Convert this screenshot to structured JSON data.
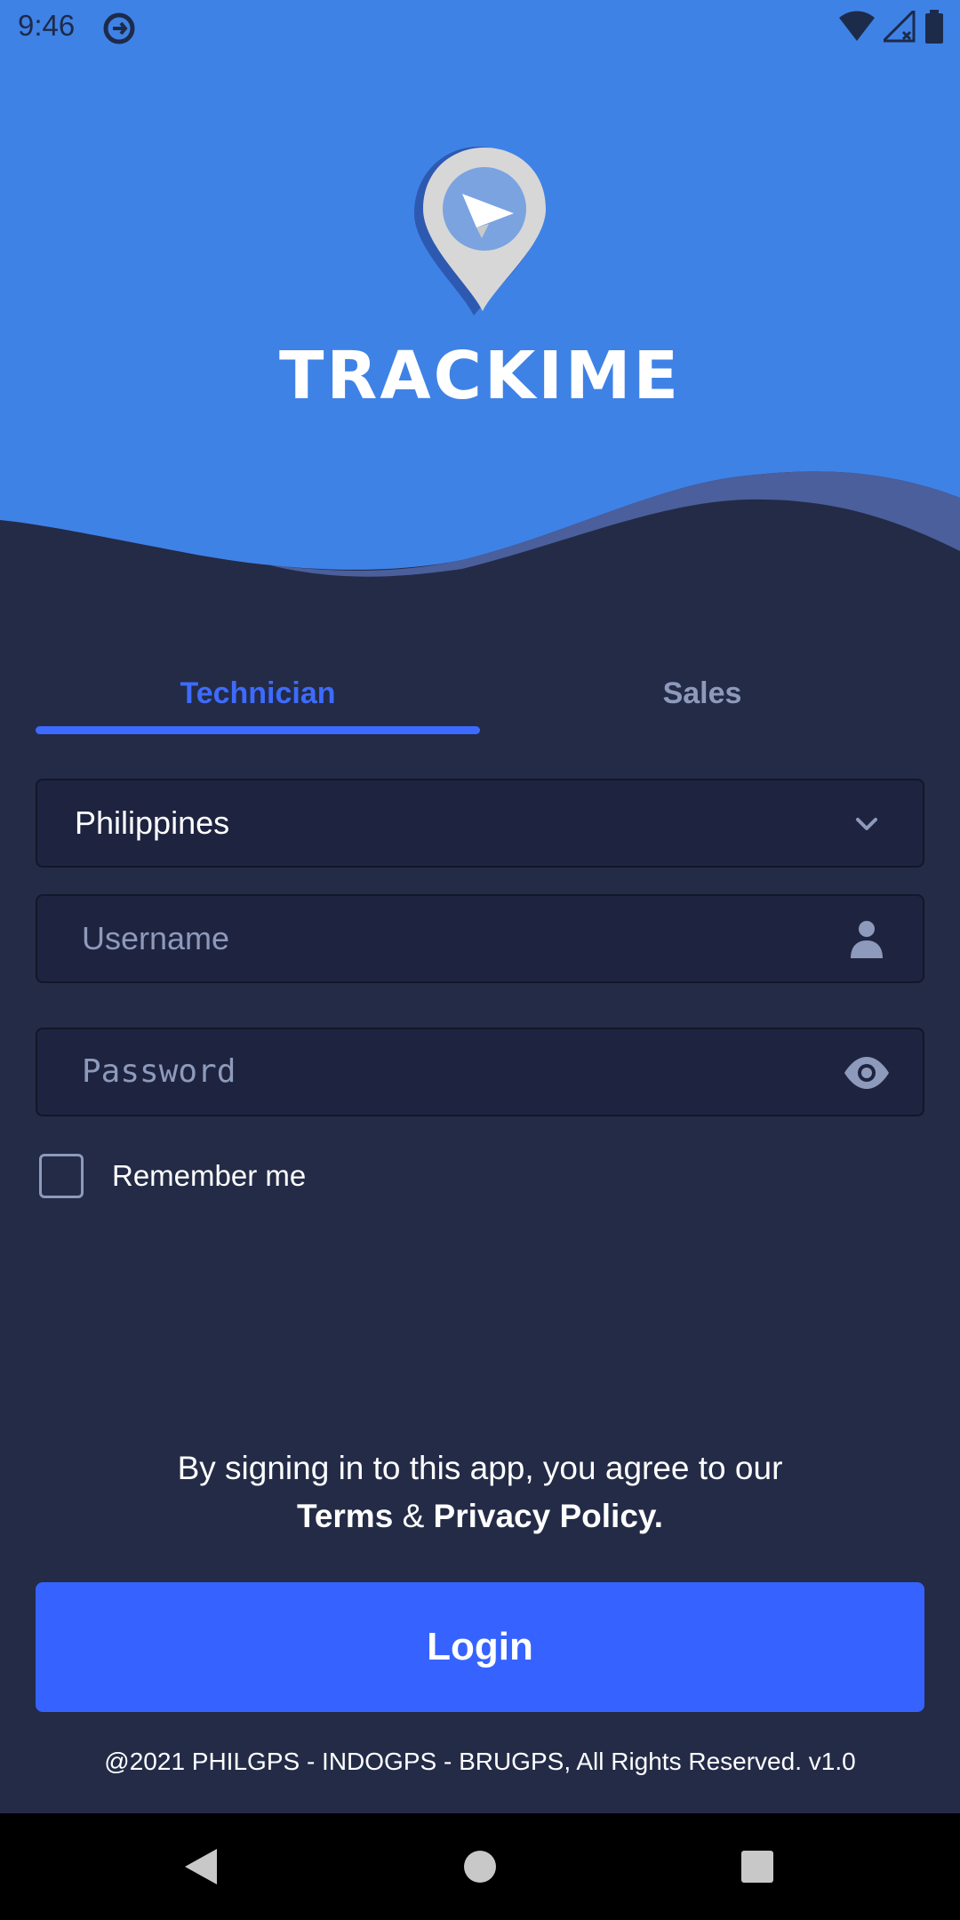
{
  "status_bar": {
    "time": "9:46",
    "icons": [
      "sync-icon",
      "wifi-icon",
      "signal-icon",
      "battery-icon"
    ]
  },
  "brand": {
    "name": "TRACKIME",
    "logo_icon": "location-pin-paper-plane-icon"
  },
  "tabs": [
    {
      "label": "Technician",
      "active": true
    },
    {
      "label": "Sales",
      "active": false
    }
  ],
  "form": {
    "country": {
      "value": "Philippines",
      "icon": "chevron-down-icon"
    },
    "username": {
      "placeholder": "Username",
      "icon": "person-icon"
    },
    "password": {
      "placeholder": "Password",
      "icon": "eye-icon"
    },
    "remember_me": {
      "label": "Remember me",
      "checked": false
    }
  },
  "agreement": {
    "text": "By signing in to this app, you agree to our",
    "terms": "Terms",
    "amp": "&",
    "privacy": "Privacy Policy."
  },
  "login_button": "Login",
  "copyright": "@2021 PHILGPS - INDOGPS - BRUGPS, All Rights Reserved. v1.0",
  "colors": {
    "header_blue": "#3f82e6",
    "background": "#232b47",
    "accent": "#3663ff",
    "muted": "#8e9abb"
  }
}
